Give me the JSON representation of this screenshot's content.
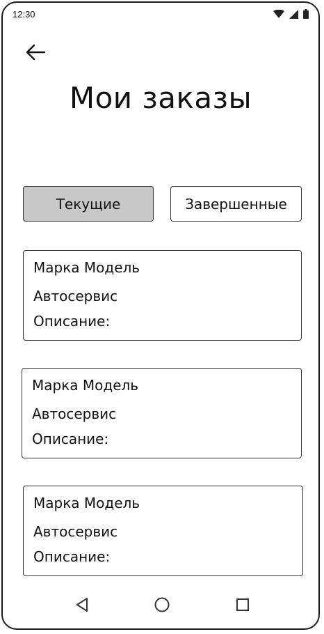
{
  "status_bar": {
    "time": "12:30",
    "icons": [
      "wifi-icon",
      "signal-icon",
      "battery-icon"
    ]
  },
  "header": {
    "back_icon": "arrow-left-icon",
    "title": "Мои заказы"
  },
  "tabs": [
    {
      "label": "Текущие",
      "selected": true
    },
    {
      "label": "Завершенные",
      "selected": false
    }
  ],
  "orders": [
    {
      "vehicle": "Марка Модель",
      "service": "Автосервис",
      "description": "Описание:"
    },
    {
      "vehicle": "Марка Модель",
      "service": "Автосервис",
      "description": "Описание:"
    },
    {
      "vehicle": "Марка Модель",
      "service": "Автосервис",
      "description": "Описание:"
    }
  ],
  "nav_bar": {
    "icons": [
      "nav-back-triangle-icon",
      "nav-home-circle-icon",
      "nav-recents-square-icon"
    ]
  },
  "colors": {
    "selected_tab": "#c8c8c8",
    "border": "#333333",
    "text": "#111111"
  }
}
